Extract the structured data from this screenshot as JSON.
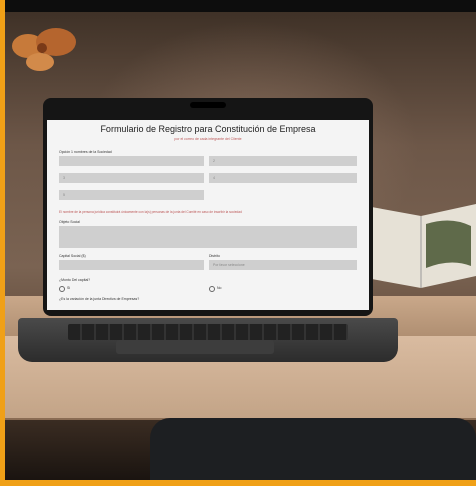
{
  "form": {
    "title": "Formulario de Registro para Constitución de Empresa",
    "subtitle": "por el correo de cada integrante del Cliente",
    "section_names_label": "Opción 1 nombres de la Sociedad",
    "fields": [
      "1",
      "2",
      "3",
      "4",
      "5"
    ],
    "note": "El nombre de la persona jurídica constituirá únicamente con la(s) personas de la junta del Comité en caso de inscribir la sociedad",
    "object_label": "Objeto Social",
    "capital_label": "Capital Social ($)",
    "district_label": "Distrito",
    "district_placeholder": "Por favor seleccione",
    "question_label": "¿Monto Del capital?",
    "yes": "Si",
    "no": "No",
    "question2_label": "¿Es la variación de la junta Directiva de Empresas?"
  }
}
